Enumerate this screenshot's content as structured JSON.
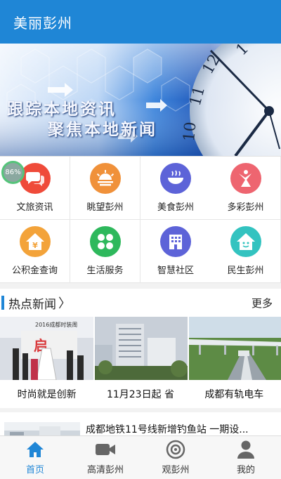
{
  "app": {
    "title": "美丽彭州"
  },
  "banner": {
    "line1": "跟踪本地资讯",
    "line2": "聚焦本地新闻"
  },
  "badge": {
    "text": "86%"
  },
  "grid": [
    {
      "label": "文旅资讯",
      "icon": "chat-bubbles-icon",
      "color": "#ef4b3a"
    },
    {
      "label": "眺望彭州",
      "icon": "sunrise-icon",
      "color": "#f0913a"
    },
    {
      "label": "美食彭州",
      "icon": "food-bowl-icon",
      "color": "#5d63d8"
    },
    {
      "label": "多彩彭州",
      "icon": "dancer-icon",
      "color": "#ee6570"
    },
    {
      "label": "公积金查询",
      "icon": "yuan-house-icon",
      "color": "#f3a33a"
    },
    {
      "label": "生活服务",
      "icon": "clover-icon",
      "color": "#2eb85c"
    },
    {
      "label": "智慧社区",
      "icon": "building-icon",
      "color": "#5d63d8"
    },
    {
      "label": "民生彭州",
      "icon": "smile-house-icon",
      "color": "#33c3c0"
    }
  ],
  "hot_news": {
    "title": "热点新闻",
    "more": "更多",
    "photo_items": [
      {
        "caption": "时尚就是创新",
        "image_text": "2016成都时装周"
      },
      {
        "caption": "11月23日起 省"
      },
      {
        "caption": "成都有轨电车"
      }
    ],
    "list_items": [
      {
        "title": "成都地铁11号线新增钓鱼站 一期设..."
      }
    ]
  },
  "tabs": [
    {
      "label": "首页",
      "icon": "home-icon",
      "active": true
    },
    {
      "label": "高清彭州",
      "icon": "video-camera-icon",
      "active": false
    },
    {
      "label": "观彭州",
      "icon": "target-eye-icon",
      "active": false
    },
    {
      "label": "我的",
      "icon": "user-icon",
      "active": false
    }
  ],
  "colors": {
    "primary": "#1f86d6",
    "background": "#f2f2f2"
  }
}
